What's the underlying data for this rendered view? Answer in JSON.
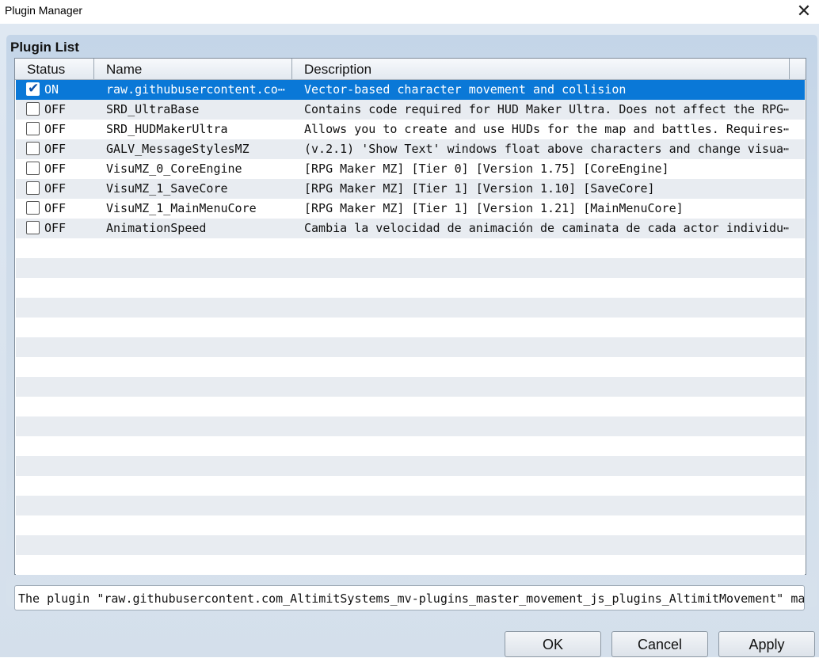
{
  "window": {
    "title": "Plugin Manager",
    "close_icon": "close-icon"
  },
  "group": {
    "label": "Plugin List"
  },
  "table": {
    "columns": [
      "Status",
      "Name",
      "Description"
    ],
    "rows": [
      {
        "checked": true,
        "status": "ON",
        "name": "raw.githubusercontent.co⋯",
        "description": "Vector-based character movement and collision"
      },
      {
        "checked": false,
        "status": "OFF",
        "name": "SRD_UltraBase",
        "description": "Contains code required for HUD Maker Ultra. Does not affect the RPG⋯"
      },
      {
        "checked": false,
        "status": "OFF",
        "name": "SRD_HUDMakerUltra",
        "description": "Allows you to create and use HUDs for the map and battles. Requires⋯"
      },
      {
        "checked": false,
        "status": "OFF",
        "name": "GALV_MessageStylesMZ",
        "description": "(v.2.1) 'Show Text' windows float above characters and change visua⋯"
      },
      {
        "checked": false,
        "status": "OFF",
        "name": "VisuMZ_0_CoreEngine",
        "description": "[RPG Maker MZ] [Tier 0] [Version 1.75] [CoreEngine]"
      },
      {
        "checked": false,
        "status": "OFF",
        "name": "VisuMZ_1_SaveCore",
        "description": "[RPG Maker MZ] [Tier 1] [Version 1.10] [SaveCore]"
      },
      {
        "checked": false,
        "status": "OFF",
        "name": "VisuMZ_1_MainMenuCore",
        "description": "[RPG Maker MZ] [Tier 1] [Version 1.21] [MainMenuCore]"
      },
      {
        "checked": false,
        "status": "OFF",
        "name": "AnimationSpeed",
        "description": "Cambia la velocidad de animación de caminata de cada actor individu⋯"
      }
    ],
    "selected_index": 0
  },
  "status_message": "The plugin \"raw.githubusercontent.com_AltimitSystems_mv-plugins_master_movement_js_plugins_AltimitMovement\" may",
  "buttons": {
    "ok": "OK",
    "cancel": "Cancel",
    "apply": "Apply"
  },
  "colors": {
    "selection": "#0a78d7",
    "row_alt": "#e8ecf1",
    "group_bg": "#c4d5e8"
  }
}
